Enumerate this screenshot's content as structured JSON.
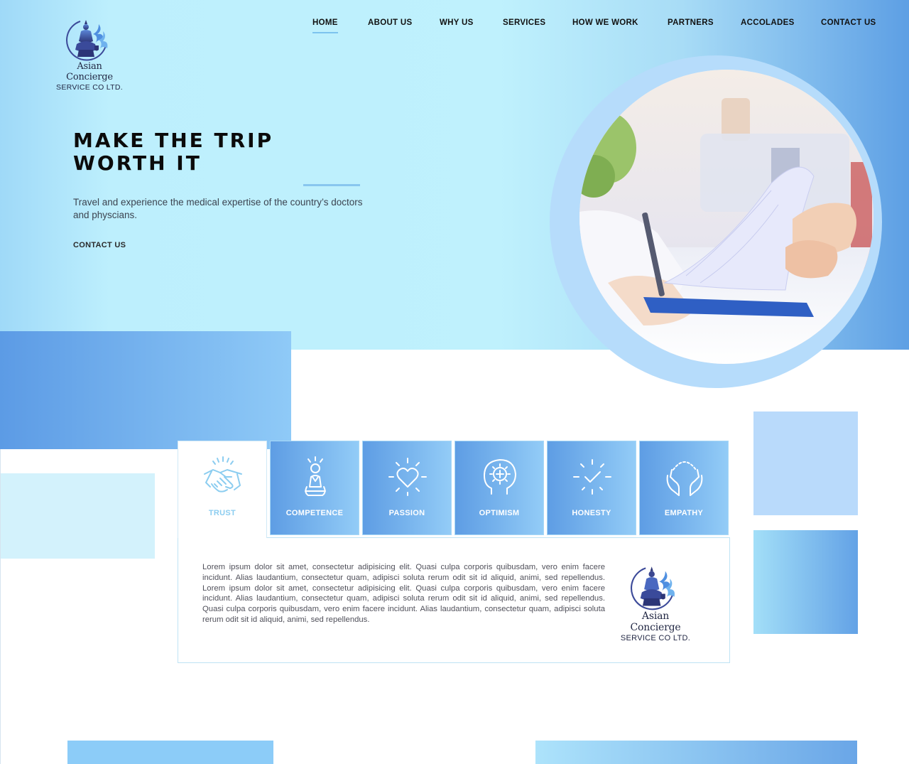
{
  "brand": {
    "name": "Asian Concierge",
    "sub": "SERVICE CO LTD."
  },
  "nav": {
    "items": [
      {
        "label": "HOME",
        "active": true
      },
      {
        "label": "ABOUT US"
      },
      {
        "label": "WHY US"
      },
      {
        "label": "SERVICES"
      },
      {
        "label": "HOW WE WORK"
      },
      {
        "label": "PARTNERS"
      },
      {
        "label": "ACCOLADES"
      },
      {
        "label": "CONTACT US"
      }
    ]
  },
  "hero": {
    "title_line1": "MAKE THE TRIP",
    "title_line2": "WORTH IT",
    "subtitle": "Travel and experience the medical expertise of the country’s doctors and physcians.",
    "cta": "CONTACT US",
    "photo_icon": "doctor-writing-clipboard-photo"
  },
  "values": {
    "tabs": [
      {
        "label": "TRUST",
        "icon": "handshake-icon",
        "active": true
      },
      {
        "label": "COMPETENCE",
        "icon": "person-award-icon"
      },
      {
        "label": "PASSION",
        "icon": "heart-icon"
      },
      {
        "label": "OPTIMISM",
        "icon": "head-idea-icon"
      },
      {
        "label": "HONESTY",
        "icon": "check-icon"
      },
      {
        "label": "EMPATHY",
        "icon": "caring-hands-icon"
      }
    ],
    "panel_text": "Lorem ipsum dolor sit amet, consectetur adipisicing elit. Quasi culpa corporis quibusdam, vero enim facere incidunt. Alias laudantium, consectetur quam, adipisci soluta rerum odit sit id aliquid, animi, sed repellendus. Lorem ipsum dolor sit amet, consectetur adipisicing elit. Quasi culpa corporis quibusdam, vero enim facere incidunt. Alias laudantium, consectetur quam, adipisci soluta rerum odit sit id aliquid, animi, sed repellendus. Quasi culpa corporis quibusdam, vero enim facere incidunt. Alias laudantium, consectetur quam, adipisci soluta rerum odit sit id aliquid, animi, sed repellendus."
  },
  "colors": {
    "accent": "#7cc3ee",
    "tab_gradient_start": "#5e9de4",
    "tab_gradient_end": "#93ccf7",
    "hero_light": "#bff1fd",
    "logo_navy": "#2f3a7a"
  }
}
